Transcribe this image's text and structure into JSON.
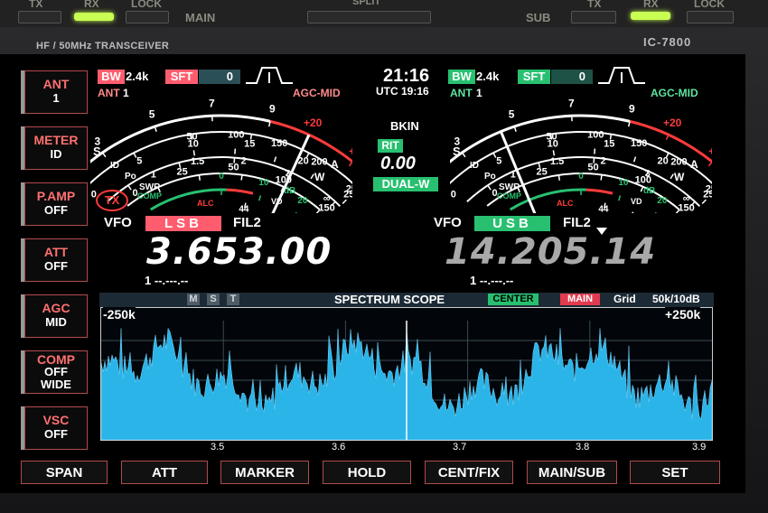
{
  "panel": {
    "tx": "TX",
    "rx": "RX",
    "lock": "LOCK",
    "main": "MAIN",
    "split": "SPLIT",
    "sub": "SUB",
    "tx2": "TX",
    "rx2": "RX",
    "lock2": "LOCK",
    "brand": "HF / 50MHz TRANSCEIVER",
    "model": "IC-7800"
  },
  "side": {
    "ant": {
      "label": "ANT",
      "value": "1"
    },
    "meter": {
      "label": "METER",
      "value": "ID"
    },
    "pamp": {
      "label": "P.AMP",
      "value": "OFF"
    },
    "att": {
      "label": "ATT",
      "value": "OFF"
    },
    "agc": {
      "label": "AGC",
      "value": "MID"
    },
    "comp": {
      "label": "COMP",
      "value1": "OFF",
      "value2": "WIDE"
    },
    "vsc": {
      "label": "VSC",
      "value": "OFF"
    }
  },
  "main": {
    "bw": "BW",
    "bw_val": "2.4k",
    "sft": "SFT",
    "sft_val": "0",
    "ant": "ANT",
    "ant_val": "1",
    "agc": "AGC-MID",
    "vfo": "VFO",
    "mode": "LSB",
    "fil": "FIL2",
    "freq": "3.653.00",
    "mem": "1 --.---.--",
    "tx": "TX"
  },
  "sub": {
    "bw": "BW",
    "bw_val": "2.4k",
    "sft": "SFT",
    "sft_val": "0",
    "ant": "ANT",
    "ant_val": "1",
    "agc": "AGC-MID",
    "vfo": "VFO",
    "mode": "USB",
    "fil": "FIL2",
    "freq": "14.205.14",
    "mem": "1 --.---.--"
  },
  "center": {
    "time": "21:16",
    "utc": "UTC 19:16",
    "bkin": "BKIN",
    "rit": "RIT",
    "rit_val": "0.00",
    "dual": "DUAL-W"
  },
  "meter": {
    "s": "S",
    "id": "ID",
    "po": "Po",
    "swr": "SWR",
    "comp": "COMP",
    "alc": "ALC",
    "a": "A",
    "w": "W",
    "db": "dB",
    "vd": "VD",
    "s_ticks": [
      "1",
      "3",
      "5",
      "7",
      "9",
      "+20",
      "+40",
      "+60dB"
    ],
    "id_ticks": [
      "0",
      "5",
      "10",
      "15",
      "20",
      "25"
    ],
    "a_ticks": [
      "50",
      "100",
      "150",
      "200",
      "250"
    ],
    "po_ticks": [
      "0",
      "25",
      "50",
      "100",
      "150"
    ],
    "swr_ticks": [
      "1",
      "1.5",
      "2",
      "3",
      "∞"
    ],
    "comp_ticks": [
      "0",
      "10",
      "20"
    ],
    "vd_ticks": [
      "44",
      "52V"
    ],
    "main_needle_level": 0.72,
    "sub_needle_level": 0.3
  },
  "scope": {
    "title": "SPECTRUM SCOPE",
    "center": "CENTER",
    "main": "MAIN",
    "grid": "Grid",
    "span": "50k/10dB",
    "m": "M",
    "s": "S",
    "t": "T",
    "left": "-250k",
    "right": "+250k",
    "axis": [
      "3.5",
      "3.6",
      "3.7",
      "3.8",
      "3.9"
    ]
  },
  "buttons": [
    "SPAN",
    "ATT",
    "MARKER",
    "HOLD",
    "CENT/FIX",
    "MAIN/SUB",
    "SET"
  ],
  "colors": {
    "red": "#ff5d6e",
    "green": "#28c070",
    "cyan": "#2bb4e8",
    "accent": "#ff6868"
  }
}
